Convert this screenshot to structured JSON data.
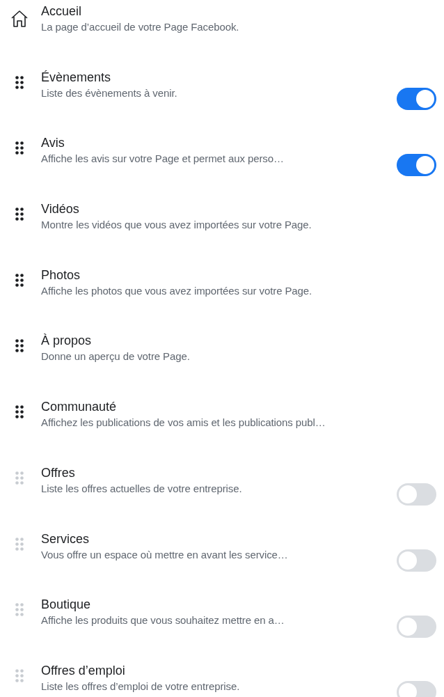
{
  "items": [
    {
      "kind": "home",
      "title": "Accueil",
      "description": "La page d’accueil de votre Page Facebook."
    },
    {
      "kind": "drag",
      "title": "Évènements",
      "description": "Liste des évènements à venir.",
      "disabled": false,
      "toggle": {
        "on": true
      }
    },
    {
      "kind": "drag",
      "title": "Avis",
      "description": "Affiche les avis sur votre Page et permet aux perso…",
      "disabled": false,
      "toggle": {
        "on": true
      }
    },
    {
      "kind": "drag",
      "title": "Vidéos",
      "description": "Montre les vidéos que vous avez importées sur votre Page.",
      "disabled": false
    },
    {
      "kind": "drag",
      "title": "Photos",
      "description": "Affiche les photos que vous avez importées sur votre Page.",
      "disabled": false
    },
    {
      "kind": "drag",
      "title": "À propos",
      "description": "Donne un aperçu de votre Page.",
      "disabled": false
    },
    {
      "kind": "drag",
      "title": "Communauté",
      "description": "Affichez les publications de vos amis et les publications publ…",
      "disabled": false
    },
    {
      "kind": "drag",
      "title": "Offres",
      "description": "Liste les offres actuelles de votre entreprise.",
      "disabled": true,
      "toggle": {
        "on": false
      }
    },
    {
      "kind": "drag",
      "title": "Services",
      "description": "Vous offre un espace où mettre en avant les service…",
      "disabled": true,
      "toggle": {
        "on": false
      }
    },
    {
      "kind": "drag",
      "title": "Boutique",
      "description": "Affiche les produits que vous souhaitez mettre en a…",
      "disabled": true,
      "toggle": {
        "on": false
      }
    },
    {
      "kind": "drag",
      "title": "Offres d’emploi",
      "description": "Liste les offres d’emploi de votre entreprise.",
      "disabled": true,
      "toggle": {
        "on": false
      }
    }
  ]
}
